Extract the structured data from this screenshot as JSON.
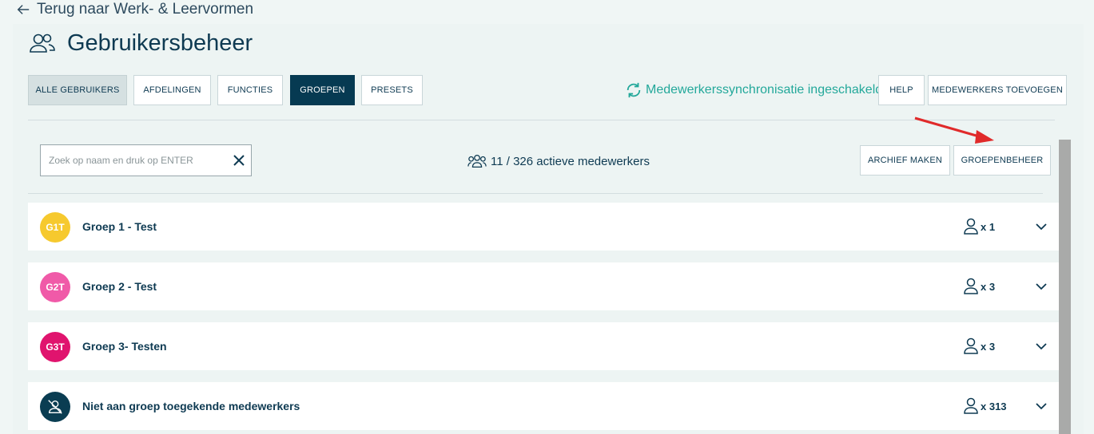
{
  "back_link": {
    "label": "Terug naar Werk- & Leervormen",
    "icon": "arrow-left-icon"
  },
  "page": {
    "title": "Gebruikersbeheer",
    "icon": "users-icon"
  },
  "tabs": [
    {
      "label": "ALLE GEBRUIKERS",
      "state": "selected-grey"
    },
    {
      "label": "AFDELINGEN",
      "state": "default"
    },
    {
      "label": "FUNCTIES",
      "state": "default"
    },
    {
      "label": "GROEPEN",
      "state": "active"
    },
    {
      "label": "PRESETS",
      "state": "default"
    }
  ],
  "sync_status": {
    "label": "Medewerkerssynchronisatie ingeschakeld",
    "icon": "sync-icon",
    "color": "#23a89a"
  },
  "header_actions": {
    "help_label": "HELP",
    "add_label": "MEDEWERKERS TOEVOEGEN"
  },
  "search": {
    "placeholder": "Zoek op naam en druk op ENTER",
    "value": ""
  },
  "employee_count": "11 / 326 actieve medewerkers",
  "toolbar": {
    "archive_label": "ARCHIEF MAKEN",
    "groups_label": "GROEPENBEHEER"
  },
  "groups": [
    {
      "initials": "G1T",
      "name": "Groep 1 - Test",
      "count": "x 1",
      "color": "#f6c92e"
    },
    {
      "initials": "G2T",
      "name": "Groep 2 - Test",
      "count": "x 3",
      "color": "#f05aa8"
    },
    {
      "initials": "G3T",
      "name": "Groep 3- Testen",
      "count": "x 3",
      "color": "#e0146e"
    },
    {
      "initials": "",
      "name": "Niet aan groep toegekende medewerkers",
      "count": "x 313",
      "color": "#0a3d52",
      "icon": "no-user-icon"
    }
  ],
  "colors": {
    "accent_dark": "#063a52",
    "annotation_arrow": "#e02a2a"
  }
}
